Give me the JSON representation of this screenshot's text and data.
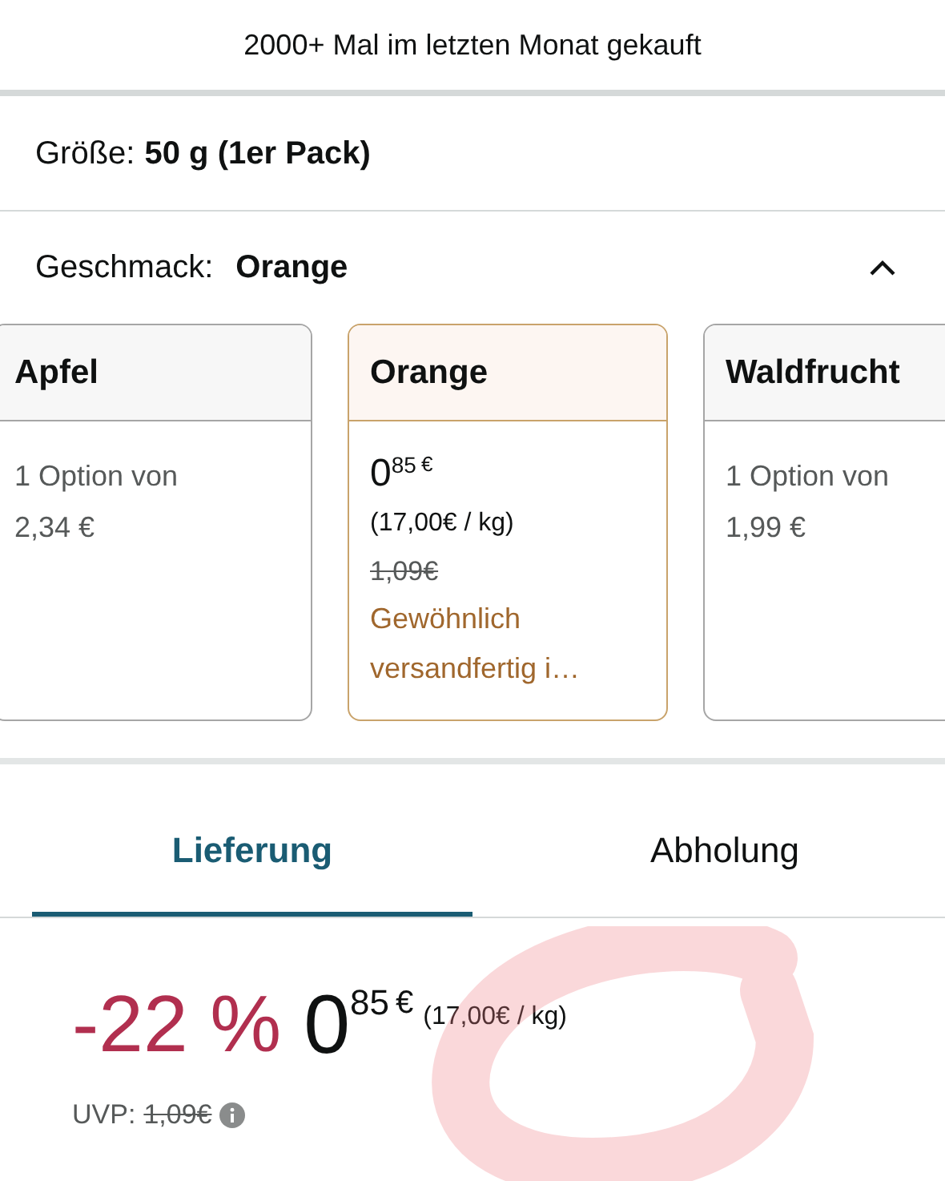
{
  "banner": "2000+ Mal im letzten Monat gekauft",
  "size": {
    "label": "Größe:",
    "value": "50 g (1er Pack)"
  },
  "flavor": {
    "label": "Geschmack:",
    "value": "Orange",
    "expanded": true
  },
  "options": [
    {
      "kind": "summary",
      "name": "Apfel",
      "selected": false,
      "line1": "1 Option von",
      "line2": "2,34 €"
    },
    {
      "kind": "price",
      "name": "Orange",
      "selected": true,
      "whole": "0",
      "fraction": "85",
      "currency": "€",
      "unit_price": "(17,00€ / kg)",
      "old_price": "1,09€",
      "availability": "Gewöhnlich versandfertig i…"
    },
    {
      "kind": "summary",
      "name": "Waldfrucht",
      "selected": false,
      "line1": "1 Option von",
      "line2": "1,99 €"
    }
  ],
  "tabs": [
    {
      "label": "Lieferung",
      "selected": true
    },
    {
      "label": "Abholung",
      "selected": false
    }
  ],
  "price": {
    "discount": "-22 %",
    "whole": "0",
    "fraction": "85",
    "currency": "€",
    "unit_price": "(17,00€ / kg)",
    "list_label": "UVP:",
    "list_price": "1,09€"
  }
}
